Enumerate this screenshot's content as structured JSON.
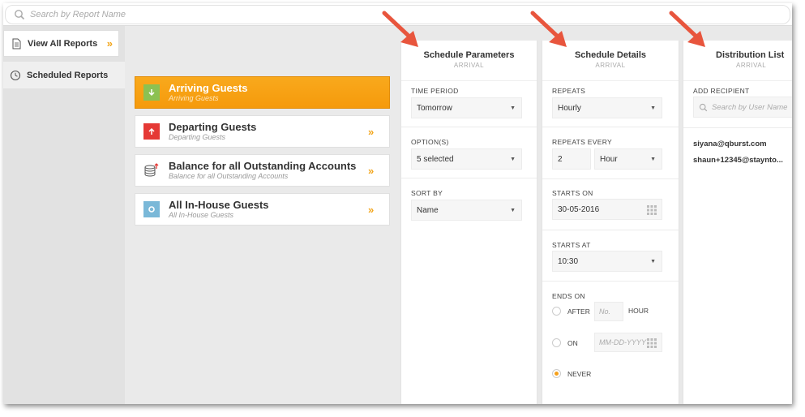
{
  "search": {
    "placeholder": "Search by Report Name"
  },
  "sidebar": {
    "items": [
      {
        "label": "View All Reports",
        "icon": "document-icon"
      },
      {
        "label": "Scheduled Reports",
        "icon": "clock-icon"
      }
    ]
  },
  "reports": [
    {
      "title": "Arriving Guests",
      "subtitle": "Arriving Guests",
      "icon": "arrow-down-icon",
      "color": "#8cc152",
      "active": true
    },
    {
      "title": "Departing Guests",
      "subtitle": "Departing Guests",
      "icon": "arrow-up-icon",
      "color": "#e53935",
      "active": false
    },
    {
      "title": "Balance for all Outstanding Accounts",
      "subtitle": "Balance for all Outstanding Accounts",
      "icon": "coins-icon",
      "color": "#555555",
      "active": false
    },
    {
      "title": "All In-House Guests",
      "subtitle": "All In-House Guests",
      "icon": "ring-icon",
      "color": "#7ab8d8",
      "active": false
    }
  ],
  "schedule_parameters": {
    "title": "Schedule Parameters",
    "subtitle": "ARRIVAL",
    "time_period_label": "TIME PERIOD",
    "time_period_value": "Tomorrow",
    "options_label": "OPTION(S)",
    "options_value": "5 selected",
    "sort_by_label": "SORT BY",
    "sort_by_value": "Name"
  },
  "schedule_details": {
    "title": "Schedule Details",
    "subtitle": "ARRIVAL",
    "repeats_label": "REPEATS",
    "repeats_value": "Hourly",
    "repeats_every_label": "REPEATS EVERY",
    "repeats_every_number": "2",
    "repeats_every_unit": "Hour",
    "starts_on_label": "STARTS ON",
    "starts_on_value": "30-05-2016",
    "starts_at_label": "STARTS AT",
    "starts_at_value": "10:30",
    "ends_on_label": "ENDS ON",
    "after_label": "AFTER",
    "after_placeholder": "No.",
    "hour_label": "HOUR",
    "on_label": "ON",
    "on_placeholder": "MM-DD-YYYY",
    "never_label": "NEVER",
    "selected_end": "never"
  },
  "distribution_list": {
    "title": "Distribution List",
    "subtitle": "ARRIVAL",
    "add_recipient_label": "ADD RECIPIENT",
    "search_placeholder": "Search by User Name",
    "recipients": [
      "siyana@qburst.com",
      "shaun+12345@staynto..."
    ]
  },
  "colors": {
    "accent": "#f5a01a",
    "arrow": "#e8553d"
  }
}
